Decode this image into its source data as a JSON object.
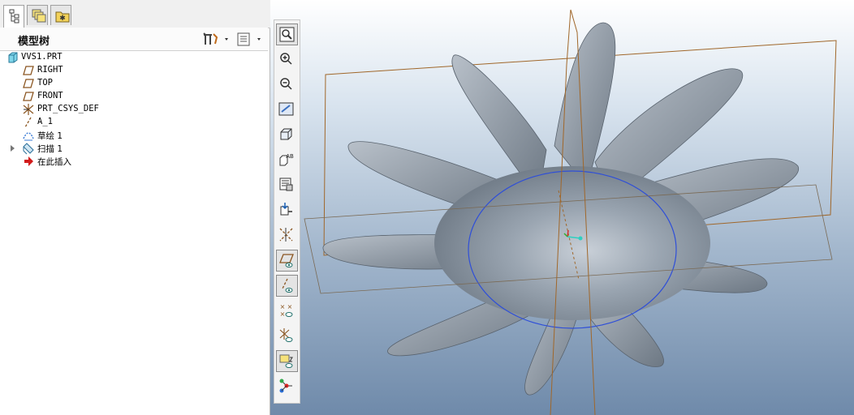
{
  "tabs": [
    {
      "name": "model-tree-tab-icon"
    },
    {
      "name": "layers-tab-icon"
    },
    {
      "name": "favorites-folder-tab-icon"
    }
  ],
  "model_tree": {
    "title": "模型树",
    "settings_icon": "tools-settings-icon",
    "show_icon": "tree-columns-icon",
    "items": [
      {
        "label": "VVS1.PRT",
        "icon": "part-icon"
      },
      {
        "label": "RIGHT",
        "icon": "datum-plane-icon"
      },
      {
        "label": "TOP",
        "icon": "datum-plane-icon"
      },
      {
        "label": "FRONT",
        "icon": "datum-plane-icon"
      },
      {
        "label": "PRT_CSYS_DEF",
        "icon": "coordinate-system-icon"
      },
      {
        "label": "A_1",
        "icon": "datum-axis-icon"
      },
      {
        "label": "草绘 1",
        "icon": "sketch-icon"
      },
      {
        "label": "扫描 1",
        "icon": "sweep-icon"
      },
      {
        "label": "在此插入",
        "icon": "insert-here-arrow-icon"
      }
    ]
  },
  "view_toolbar": [
    {
      "name": "refit-zoom-icon"
    },
    {
      "name": "zoom-in-icon"
    },
    {
      "name": "zoom-out-icon"
    },
    {
      "name": "repaint-icon"
    },
    {
      "name": "display-style-icon"
    },
    {
      "name": "saved-orientations-icon"
    },
    {
      "name": "view-manager-icon"
    },
    {
      "name": "perspective-view-icon"
    },
    {
      "name": "annotation-display-icon"
    },
    {
      "name": "plane-display-icon"
    },
    {
      "name": "axis-display-icon"
    },
    {
      "name": "point-display-icon"
    },
    {
      "name": "csys-display-icon"
    },
    {
      "name": "annotation-visibility-icon"
    },
    {
      "name": "spin-center-icon"
    }
  ],
  "colors": {
    "model_gray": "#8c97a3",
    "datum_orange": "#a0672a",
    "sketch_blue": "#2f4fd8",
    "bg_bottom": "#6f8aaa"
  }
}
